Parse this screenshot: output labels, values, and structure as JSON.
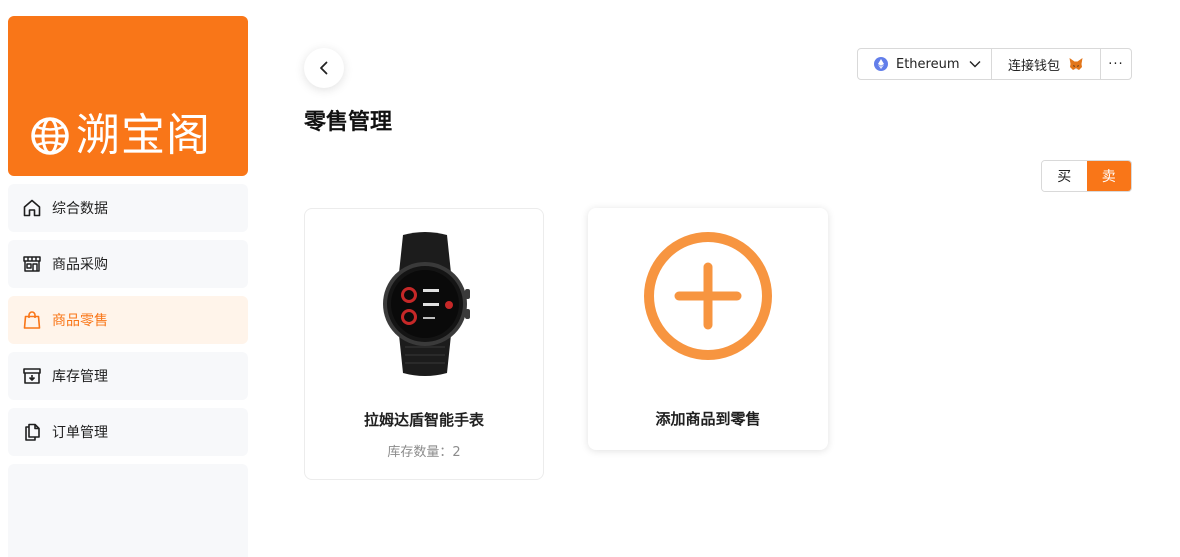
{
  "brand": {
    "name": "溯宝阁",
    "color": "#f97618"
  },
  "sidebar": {
    "items": [
      {
        "label": "综合数据",
        "icon": "home-icon",
        "active": false
      },
      {
        "label": "商品采购",
        "icon": "store-icon",
        "active": false
      },
      {
        "label": "商品零售",
        "icon": "shopping-bag-icon",
        "active": true
      },
      {
        "label": "库存管理",
        "icon": "archive-icon",
        "active": false
      },
      {
        "label": "订单管理",
        "icon": "documents-icon",
        "active": false
      }
    ]
  },
  "header": {
    "title": "零售管理",
    "network": "Ethereum",
    "connect_label": "连接钱包",
    "more_label": "···"
  },
  "mode_toggle": {
    "buy_label": "买",
    "sell_label": "卖",
    "selected": "卖"
  },
  "products": [
    {
      "name": "拉姆达盾智能手表",
      "stock_text": "库存数量：2"
    }
  ],
  "add_card": {
    "label": "添加商品到零售"
  }
}
